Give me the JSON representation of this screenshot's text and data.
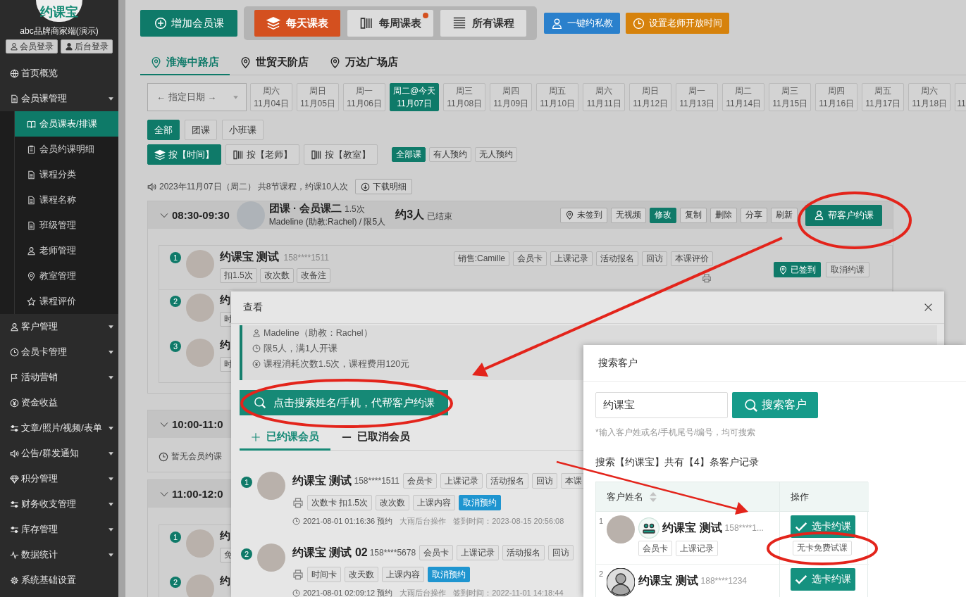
{
  "sidebar": {
    "logo": "约课宝",
    "brand": "abc品牌商家端(演示)",
    "login_buttons": [
      "会员登录",
      "后台登录"
    ],
    "items": [
      {
        "label": "首页概览",
        "selected": false,
        "has_submenu": false
      },
      {
        "label": "会员课管理",
        "selected": false,
        "has_submenu": true,
        "children": [
          {
            "label": "会员课表/排课",
            "selected": true
          },
          {
            "label": "会员约课明细",
            "selected": false
          },
          {
            "label": "课程分类",
            "selected": false
          },
          {
            "label": "课程名称",
            "selected": false
          },
          {
            "label": "班级管理",
            "selected": false
          },
          {
            "label": "老师管理",
            "selected": false
          },
          {
            "label": "教室管理",
            "selected": false
          },
          {
            "label": "课程评价",
            "selected": false
          }
        ]
      },
      {
        "label": "客户管理",
        "selected": false,
        "has_submenu": true
      },
      {
        "label": "会员卡管理",
        "selected": false,
        "has_submenu": true
      },
      {
        "label": "活动营销",
        "selected": false,
        "has_submenu": true
      },
      {
        "label": "资金收益",
        "selected": false,
        "has_submenu": false
      },
      {
        "label": "文章/照片/视频/表单",
        "selected": false,
        "has_submenu": true
      },
      {
        "label": "公告/群发通知",
        "selected": false,
        "has_submenu": true
      },
      {
        "label": "积分管理",
        "selected": false,
        "has_submenu": true
      },
      {
        "label": "财务收支管理",
        "selected": false,
        "has_submenu": true
      },
      {
        "label": "库存管理",
        "selected": false,
        "has_submenu": true
      },
      {
        "label": "数据统计",
        "selected": false,
        "has_submenu": true
      },
      {
        "label": "系统基础设置",
        "selected": false,
        "has_submenu": false
      }
    ]
  },
  "toolbar": {
    "add_button": "增加会员课",
    "views": [
      {
        "label": "每天课表",
        "selected": true,
        "dot": false
      },
      {
        "label": "每周课表",
        "selected": false,
        "dot": true
      },
      {
        "label": "所有课程",
        "selected": false,
        "dot": false
      }
    ],
    "actions": [
      {
        "label": "一键约私教",
        "color": "#2a80cc"
      },
      {
        "label": "设置老师开放时间",
        "color": "#d6820c"
      }
    ]
  },
  "stores": [
    {
      "label": "淮海中路店",
      "selected": true
    },
    {
      "label": "世贸天阶店",
      "selected": false
    },
    {
      "label": "万达广场店",
      "selected": false
    }
  ],
  "date_picker": "← 指定日期 →",
  "dates": [
    {
      "weekday": "周六",
      "date": "11月04日",
      "selected": false
    },
    {
      "weekday": "周日",
      "date": "11月05日",
      "selected": false
    },
    {
      "weekday": "周一",
      "date": "11月06日",
      "selected": false
    },
    {
      "weekday": "周二@今天",
      "date": "11月07日",
      "selected": true
    },
    {
      "weekday": "周三",
      "date": "11月08日",
      "selected": false
    },
    {
      "weekday": "周四",
      "date": "11月09日",
      "selected": false
    },
    {
      "weekday": "周五",
      "date": "11月10日",
      "selected": false
    },
    {
      "weekday": "周六",
      "date": "11月11日",
      "selected": false
    },
    {
      "weekday": "周日",
      "date": "11月12日",
      "selected": false
    },
    {
      "weekday": "周一",
      "date": "11月13日",
      "selected": false
    },
    {
      "weekday": "周二",
      "date": "11月14日",
      "selected": false
    },
    {
      "weekday": "周三",
      "date": "11月15日",
      "selected": false
    },
    {
      "weekday": "周四",
      "date": "11月16日",
      "selected": false
    },
    {
      "weekday": "周五",
      "date": "11月17日",
      "selected": false
    },
    {
      "weekday": "周六",
      "date": "11月18日",
      "selected": false
    },
    {
      "date": "11",
      "selected": false
    }
  ],
  "type_filters": [
    {
      "label": "全部",
      "selected": true
    },
    {
      "label": "团课",
      "selected": false
    },
    {
      "label": "小班课",
      "selected": false
    }
  ],
  "group_by": [
    {
      "label": "按【时间】",
      "selected": true
    },
    {
      "label": "按【老师】",
      "selected": false
    },
    {
      "label": "按【教室】",
      "selected": false
    }
  ],
  "booking_filters": [
    {
      "label": "全部课",
      "selected": true
    },
    {
      "label": "有人预约",
      "selected": false
    },
    {
      "label": "无人预约",
      "selected": false
    }
  ],
  "summary": {
    "text": "2023年11月07日（周二） 共8节课程，约课10人次",
    "download_button": "下载明细"
  },
  "sessions": [
    {
      "time": "08:30-09:30",
      "title": "团课 · 会员课二",
      "credits": "1.5次",
      "teacher": "Madeline (助教:Rachel) / 限5人",
      "booked": "约3人",
      "status": "已结束",
      "actions": [
        {
          "label": "未签到",
          "kind": "checkin"
        },
        {
          "label": "无视频",
          "kind": "plain"
        },
        {
          "label": "修改",
          "kind": "primary"
        },
        {
          "label": "复制",
          "kind": "plain"
        },
        {
          "label": "删除",
          "kind": "plain"
        },
        {
          "label": "分享",
          "kind": "plain"
        },
        {
          "label": "刷新",
          "kind": "plain"
        }
      ],
      "book_button": "帮客户约课",
      "members": [
        {
          "number": "1",
          "name": "约课宝 测试",
          "phone": "158****1511",
          "tags": [
            "扣1.5次",
            "改次数",
            "改备注"
          ],
          "links": [
            "销售:Camille",
            "会员卡",
            "上课记录",
            "活动报名",
            "回访",
            "本课评价"
          ],
          "checkin_button": "已签到",
          "cancel_button": "取消约课"
        },
        {
          "number": "2",
          "name": "约",
          "tags": [
            "时"
          ]
        },
        {
          "number": "3",
          "name": "约",
          "tags": [
            "时"
          ]
        }
      ]
    },
    {
      "time": "10:00-11:0",
      "empty_text": "暂无会员约课"
    },
    {
      "time": "11:00-12:0",
      "members": [
        {
          "number": "1",
          "name": "约",
          "tags": [
            "免"
          ]
        },
        {
          "number": "2",
          "name": "约"
        }
      ]
    }
  ],
  "detail_dialog": {
    "title": "查看",
    "info": [
      "Madeline（助教：Rachel）",
      "限5人，满1人开课",
      "课程消耗次数1.5次，课程费用120元"
    ],
    "search_button": "点击搜索姓名/手机，代帮客户约课",
    "tabs": [
      {
        "label": "已约课会员",
        "selected": true
      },
      {
        "label": "已取消会员",
        "selected": false
      }
    ],
    "members": [
      {
        "number": "1",
        "name": "约课宝 测试",
        "phone": "158****1511",
        "links": [
          "会员卡",
          "上课记录",
          "活动报名",
          "回访",
          "本课"
        ],
        "tags": [
          "次数卡 扣1.5次",
          "改次数",
          "上课内容"
        ],
        "cancel_button": "取消预约",
        "booked_at": "2021-08-01 01:16:36 预约",
        "operator": "大雨后台操作",
        "checkin_time": "签到时间：2023-08-15 20:56:08"
      },
      {
        "number": "2",
        "name": "约课宝 测试 02",
        "phone": "158****5678",
        "links": [
          "会员卡",
          "上课记录",
          "活动报名",
          "回访"
        ],
        "tags": [
          "时间卡",
          "改天数",
          "上课内容"
        ],
        "cancel_button": "取消预约",
        "booked_at": "2021-08-01 02:09:12 预约",
        "operator": "大雨后台操作",
        "checkin_time": "签到时间：2022-11-01 14:18:44"
      }
    ]
  },
  "search_dialog": {
    "title": "搜索客户",
    "query": "约课宝",
    "search_button": "搜索客户",
    "hint": "*输入客户姓或名/手机尾号/编号，均可搜索",
    "result_text": "搜索【约课宝】共有【4】条客户记录",
    "columns": [
      "客户姓名",
      "操作"
    ],
    "rows": [
      {
        "index": "1",
        "avatar": {
          "kind": "photo"
        },
        "brand_badge": true,
        "name": "约课宝 测试",
        "phone": "158****1...",
        "tags": [
          "会员卡",
          "上课记录"
        ],
        "book_button": "选卡约课",
        "trial_button": "无卡免费试课"
      },
      {
        "index": "2",
        "avatar": {
          "kind": "placeholder"
        },
        "brand_badge": false,
        "name": "约课宝 测试",
        "phone": "188****1234",
        "book_button": "选卡约课"
      }
    ]
  }
}
